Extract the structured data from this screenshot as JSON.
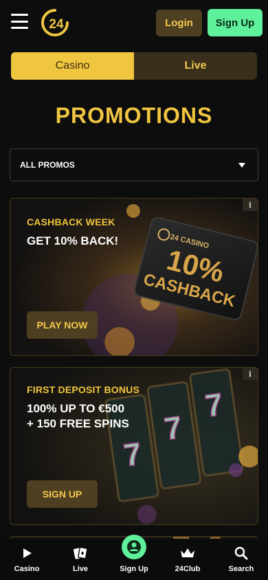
{
  "header": {
    "login_label": "Login",
    "signup_label": "Sign Up",
    "logo_text": "24"
  },
  "toggle": {
    "options": [
      {
        "label": "Casino",
        "active": true
      },
      {
        "label": "Live",
        "active": false
      }
    ]
  },
  "page": {
    "title": "PROMOTIONS"
  },
  "filter": {
    "selected": "ALL PROMOS"
  },
  "promos": [
    {
      "kicker": "CASHBACK WEEK",
      "headline": "GET 10% BACK!",
      "cta": "PLAY NOW",
      "art_brand": "24 CASINO",
      "art_big": "10%",
      "art_word": "CASHBACK",
      "info": "i"
    },
    {
      "kicker": "FIRST DEPOSIT BONUS",
      "headline_lines": [
        "100% UP TO €500",
        "+ 150 FREE SPINS"
      ],
      "cta": "SIGN UP",
      "info": "i"
    }
  ],
  "bottom_nav": [
    {
      "label": "Casino",
      "icon": "play-icon"
    },
    {
      "label": "Live",
      "icon": "cards-icon"
    },
    {
      "label": "Sign Up",
      "icon": "user-icon"
    },
    {
      "label": "24Club",
      "icon": "crown-icon"
    },
    {
      "label": "Search",
      "icon": "search-icon"
    }
  ],
  "colors": {
    "background": "#0d0d0d",
    "gold": "#f0c540",
    "gold_dark": "#4e3e22",
    "green": "#5ef09a"
  }
}
